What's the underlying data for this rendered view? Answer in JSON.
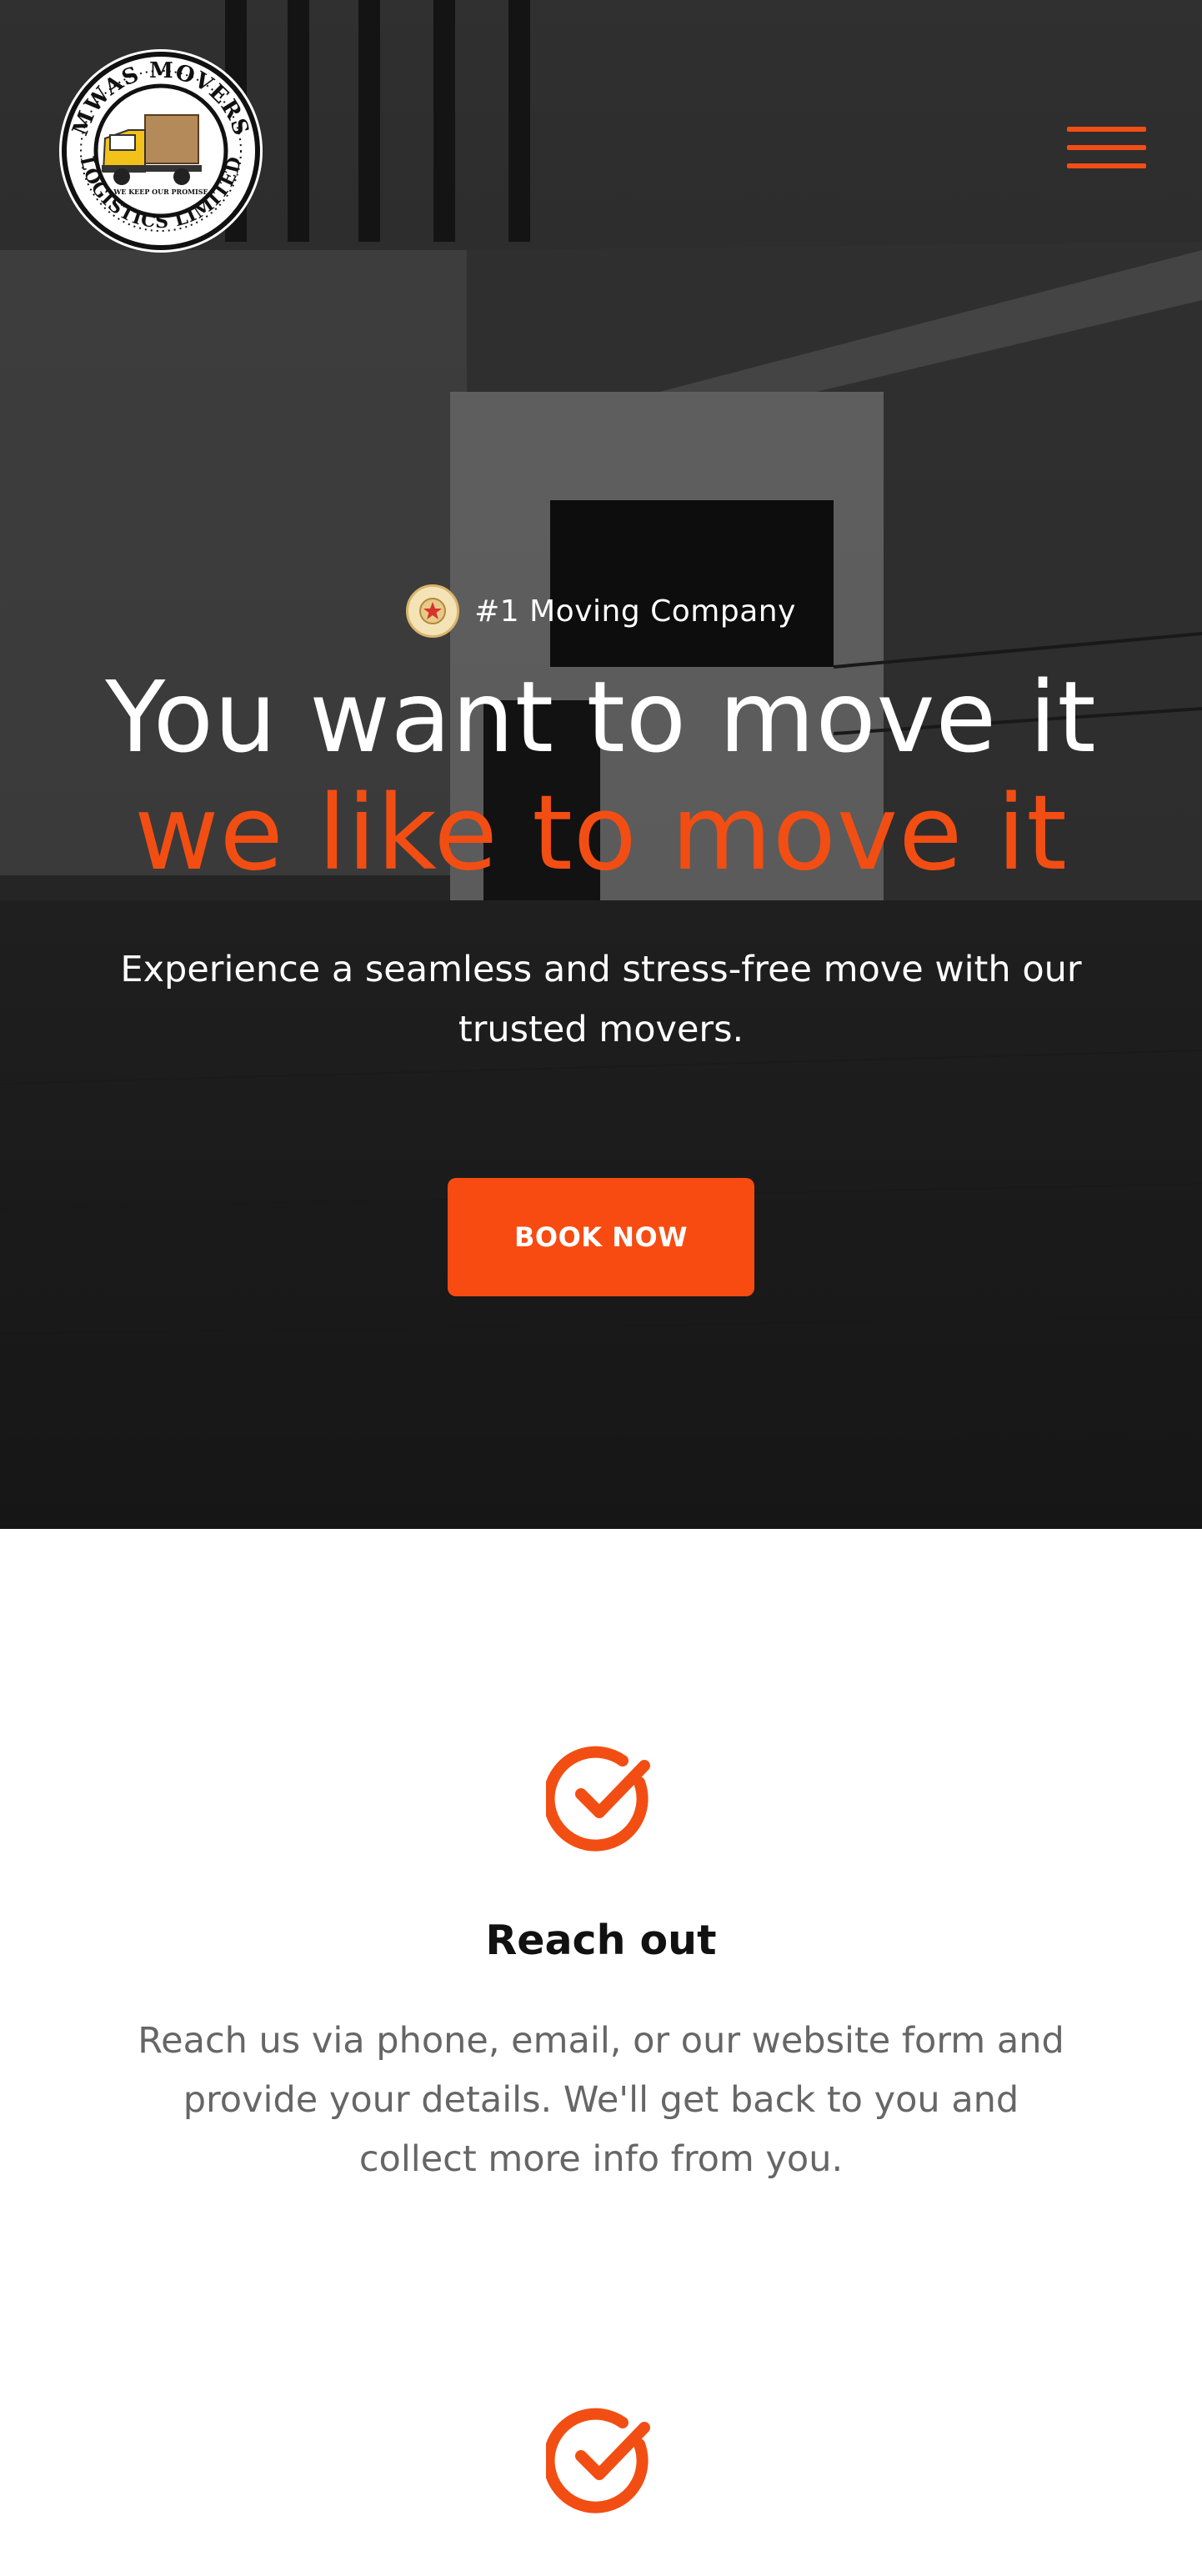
{
  "brand": {
    "name": "MWAS MOVERS & LOGISTICS LIMITED",
    "tagline": "WE KEEP OUR PROMISE",
    "accent_color": "#f24e13"
  },
  "header": {
    "menu_icon": "hamburger-menu-icon"
  },
  "hero": {
    "badge_icon": "star-badge-icon",
    "badge_text": "#1 Moving Company",
    "title_line1": "You want to move it",
    "title_line2": "we like to move it",
    "subtitle": "Experience a seamless and stress-free move with our trusted movers.",
    "cta_label": "BOOK NOW"
  },
  "steps": [
    {
      "icon": "check-circle-icon",
      "title": "Reach out",
      "description": "Reach us via phone, email, or our website form and provide your details. We'll get back to you and collect more info from you."
    },
    {
      "icon": "check-circle-icon"
    }
  ]
}
